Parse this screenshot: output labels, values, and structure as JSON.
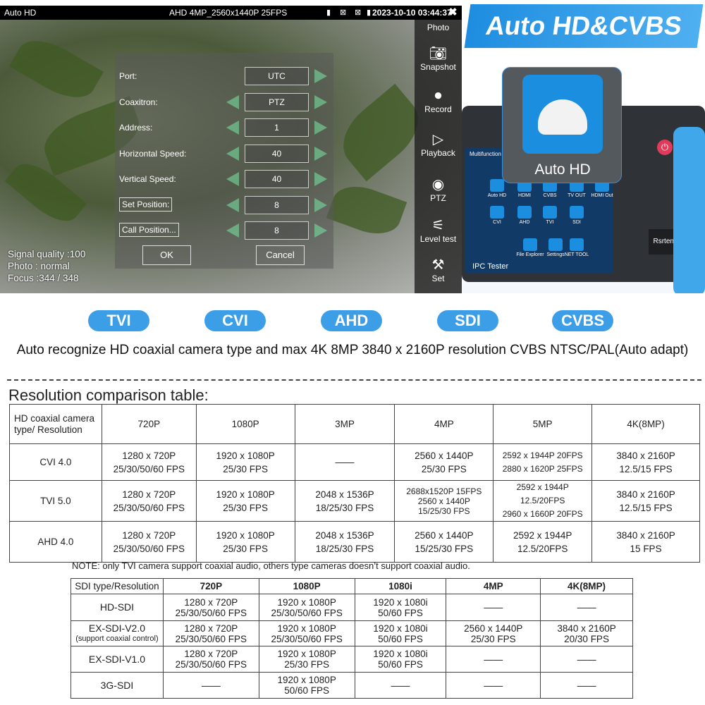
{
  "screen": {
    "topbar": {
      "mode": "Auto HD",
      "signal": "AHD  4MP_2560x1440P 25FPS",
      "datetime": "2023-10-10 03:44:37",
      "icons": [
        "sd-card-icon",
        "no-network-icon",
        "no-ip-icon",
        "battery-icon",
        "close-icon"
      ]
    },
    "side_menu": [
      {
        "label": "Photo",
        "icon": ""
      },
      {
        "label": "Snapshot",
        "icon": "camera-icon"
      },
      {
        "label": "Record",
        "icon": "video-icon"
      },
      {
        "label": "Playback",
        "icon": "play-icon"
      },
      {
        "label": "PTZ",
        "icon": "ptz-camera-icon"
      },
      {
        "label": "Level test",
        "icon": "level-icon"
      },
      {
        "label": "Set",
        "icon": "tools-icon"
      }
    ],
    "dialog": {
      "rows": [
        {
          "label": "Port:",
          "value": "UTC",
          "left_arrow": false
        },
        {
          "label": "Coaxitron:",
          "value": "PTZ",
          "left_arrow": true
        },
        {
          "label": "Address:",
          "value": "1",
          "left_arrow": true
        },
        {
          "label": "Horizontal Speed:",
          "value": "40",
          "left_arrow": true
        },
        {
          "label": "Vertical Speed:",
          "value": "40",
          "left_arrow": true
        },
        {
          "label": "Set Position:",
          "value": "8",
          "left_arrow": true,
          "button": true
        },
        {
          "label": "Call Position...",
          "value": "8",
          "left_arrow": true,
          "button": true
        }
      ],
      "ok": "OK",
      "cancel": "Cancel"
    },
    "status": {
      "signal_quality": "Signal quality :100",
      "photo": "Photo : normal",
      "focus": "Focus :344 / 348"
    }
  },
  "promo": {
    "title": "Auto HD&CVBS",
    "badge": "Auto HD",
    "device_label": "IPC Tester",
    "brand": "Rsrteng",
    "screen_title": "Multifunction Tester",
    "apps": [
      "Auto HD",
      "HDMI",
      "CVBS",
      "TV OUT",
      "HDMI Out",
      "CVI",
      "AHD",
      "TVI",
      "SDI"
    ],
    "dock": [
      "File Explorer",
      "Settings",
      "NET TOOL"
    ]
  },
  "pills": [
    "TVI",
    "CVI",
    "AHD",
    "SDI",
    "CVBS"
  ],
  "pill_color": "#3d9ee8",
  "description": "Auto recognize HD coaxial camera type and max 4K 8MP 3840 x 2160P resolution CVBS NTSC/PAL(Auto adapt)",
  "resolution_title": "Resolution comparison table:",
  "table1": {
    "headers": [
      "HD coaxial camera type/ Resolution",
      "720P",
      "1080P",
      "3MP",
      "4MP",
      "5MP",
      "4K(8MP)"
    ],
    "rows": [
      [
        "CVI 4.0",
        [
          "1280 x 720P",
          "25/30/50/60 FPS"
        ],
        [
          "1920 x 1080P",
          "25/30 FPS"
        ],
        [
          "——"
        ],
        [
          "2560 x 1440P",
          "25/30 FPS"
        ],
        [
          "2592 x 1944P 20FPS",
          "2880 x 1620P 25FPS"
        ],
        [
          "3840 x 2160P",
          "12.5/15 FPS"
        ]
      ],
      [
        "TVI 5.0",
        [
          "1280 x 720P",
          "25/30/50/60 FPS"
        ],
        [
          "1920 x 1080P",
          "25/30 FPS"
        ],
        [
          "2048 x 1536P",
          "18/25/30 FPS"
        ],
        [
          "2688x1520P 15FPS",
          "2560 x 1440P",
          "15/25/30 FPS"
        ],
        [
          "2592 x 1944P 12.5/20FPS",
          "2960 x 1660P 20FPS"
        ],
        [
          "3840 x 2160P",
          "12.5/15 FPS"
        ]
      ],
      [
        "AHD 4.0",
        [
          "1280 x 720P",
          "25/30/50/60 FPS"
        ],
        [
          "1920 x 1080P",
          "25/30 FPS"
        ],
        [
          "2048 x 1536P",
          "18/25/30 FPS"
        ],
        [
          "2560 x 1440P",
          "15/25/30 FPS"
        ],
        [
          "2592 x 1944P",
          "12.5/20FPS"
        ],
        [
          "3840 x 2160P",
          "15 FPS"
        ]
      ]
    ]
  },
  "note": "NOTE: only TVI camera support coaxial audio, others type cameras doesn’t support coaxial audio.",
  "table2": {
    "headers": [
      "SDI type/Resolution",
      "720P",
      "1080P",
      "1080i",
      "4MP",
      "4K(8MP)"
    ],
    "rows": [
      [
        [
          "HD-SDI"
        ],
        [
          "1280 x 720P",
          "25/30/50/60 FPS"
        ],
        [
          "1920 x 1080P",
          "25/30/50/60 FPS"
        ],
        [
          "1920 x 1080i",
          "50/60 FPS"
        ],
        [
          "——"
        ],
        [
          "——"
        ]
      ],
      [
        [
          "EX-SDI-V2.0",
          "(support coaxial control)"
        ],
        [
          "1280 x 720P",
          "25/30/50/60 FPS"
        ],
        [
          "1920 x 1080P",
          "25/30/50/60 FPS"
        ],
        [
          "1920 x 1080i",
          "50/60 FPS"
        ],
        [
          "2560 x 1440P",
          "25/30 FPS"
        ],
        [
          "3840 x 2160P",
          "20/30 FPS"
        ]
      ],
      [
        [
          "EX-SDI-V1.0"
        ],
        [
          "1280 x 720P",
          "25/30/50/60 FPS"
        ],
        [
          "1920 x 1080P",
          "25/30 FPS"
        ],
        [
          "1920 x 1080i",
          "50/60 FPS"
        ],
        [
          "——"
        ],
        [
          "——"
        ]
      ],
      [
        [
          "3G-SDI"
        ],
        [
          "——"
        ],
        [
          "1920 x 1080P",
          "50/60 FPS"
        ],
        [
          "——"
        ],
        [
          "——"
        ],
        [
          "——"
        ]
      ]
    ]
  }
}
